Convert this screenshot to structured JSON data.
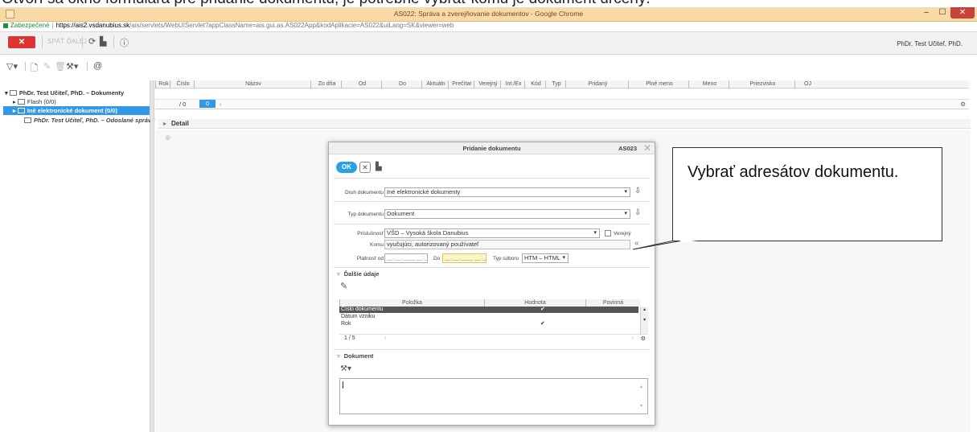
{
  "caption": "Otvorí sa okno formulára pre pridanie dokumentu, je potrebné vybrať komu je dokument určený.",
  "window": {
    "title": "AS022: Správa a zverejňovanie dokumentov - Google Chrome",
    "min": "–",
    "max": "☐",
    "close": "✕"
  },
  "url": {
    "secure_label": "Zabezpečené",
    "host": "https://ais2.vsdanubius.sk",
    "path": "/ais/servlets/WebUIServlet?appClassName=ais.gui.as.AS022App&kodAplikacie=AS022&uiLang=SK&viewer=web"
  },
  "toolbar": {
    "close_label": "✕",
    "btn_a": "SPÄŤ",
    "btn_b": "ĎALEJ",
    "refresh_icon": "⟳",
    "chart_icon": "▙",
    "info_icon": "ⓘ",
    "user": "PhDr. Test Učiteľ, PhD."
  },
  "toolbar2": {
    "filter": "▽▾",
    "new_doc": "🗋",
    "edit": "✎",
    "delete": "🗑",
    "tools": "⚒▾",
    "at": "@"
  },
  "tree": {
    "root": "PhDr. Test Učiteľ, PhD. – Dokumenty",
    "flash": "Flash (0/0)",
    "other": "Iné elektronické dokument (0/0)",
    "sent": "PhDr. Test Učiteľ, PhD. – Odoslané správy"
  },
  "grid": {
    "columns": [
      "Rok",
      "Číslo",
      "Názov",
      "Zo dňa",
      "Od",
      "Do",
      "Aktuáln",
      "Prečítar",
      "Verejný",
      "Int./Ex",
      "Kód",
      "Typ",
      "Pridaný",
      "Plné meno",
      "Meno",
      "Priezvisko",
      "OJ"
    ],
    "pager_total": "/ 0",
    "pager_current": "0",
    "pager_prev": "‹",
    "gear": "⚙"
  },
  "detail": {
    "label": "Detail"
  },
  "dialog": {
    "title": "Pridanie dokumentu",
    "code": "AS023",
    "ok_label": "OK",
    "cancel_icon": "✕",
    "druh_label": "Druh dokumentu",
    "druh_value": "Iné elektronické dokumenty",
    "typ_label": "Typ dokumentu",
    "typ_value": "Dokument",
    "prislusnost_label": "Príslušnosť",
    "prislusnost_value": "VŠD – Vysoká škola Danubius",
    "verejny_label": "Verejný",
    "komu_label": "Komu",
    "komu_value": "vyučujúci, autorizovaný používateľ",
    "komu_btn": "«",
    "platnost_label": "Platnosť od",
    "platnost_value": "__.__.____ __:__",
    "do_label": "Do",
    "do_value": "__.__.____ __:__",
    "typ_suboru_label": "Typ súboru",
    "typ_suboru_value": "HTM – HTML",
    "dalsie_title": "Ďalšie údaje",
    "table_headers": [
      "Položka",
      "Hodnota",
      "Povinná"
    ],
    "table_rows": [
      {
        "polozka": "Číslo dokumentu",
        "povinna": "✔"
      },
      {
        "polozka": "Dátum vzniku",
        "povinna": ""
      },
      {
        "polozka": "Rok",
        "povinna": "✔"
      }
    ],
    "table_pager": "1 / 5",
    "dokument_title": "Dokument"
  },
  "callout": {
    "text": "Vybrať adresátov dokumentu."
  }
}
